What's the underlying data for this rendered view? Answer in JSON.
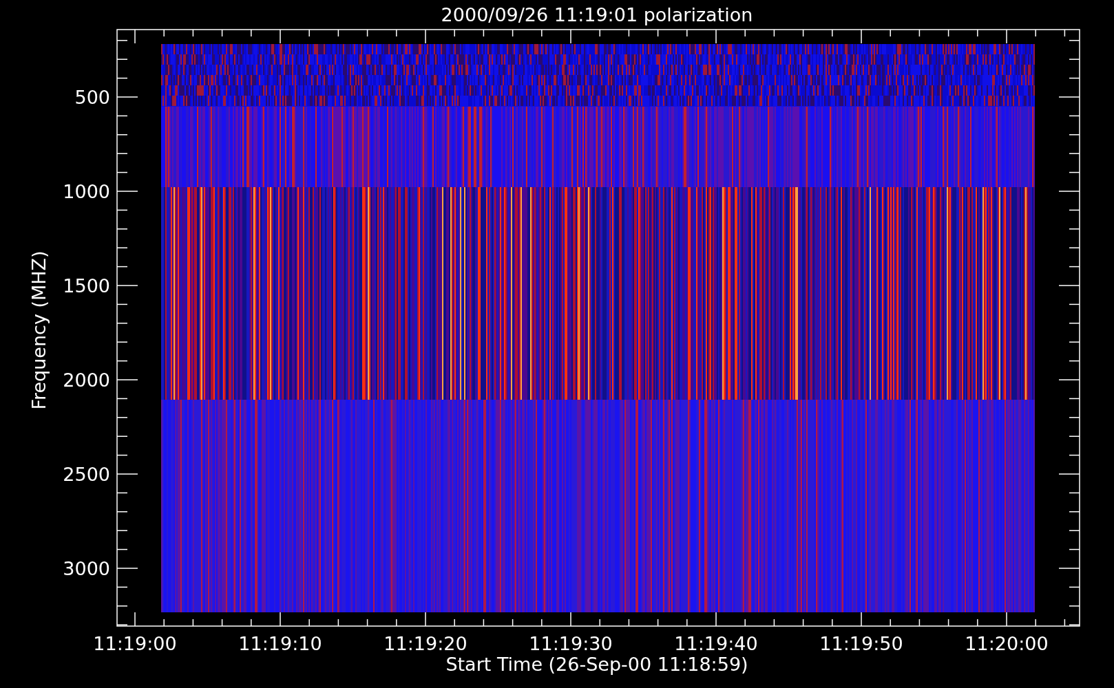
{
  "plot": {
    "title": "2000/09/26 11:19:01 polarization",
    "xlabel": "Start Time (26-Sep-00 11:18:59)",
    "ylabel": "Frequency (MHZ)",
    "yticks": [
      "500",
      "1000",
      "1500",
      "2000",
      "2500",
      "3000"
    ],
    "xticks": [
      "11:19:00",
      "11:19:10",
      "11:19:20",
      "11:19:30",
      "11:19:40",
      "11:19:50",
      "11:20:00"
    ]
  }
}
